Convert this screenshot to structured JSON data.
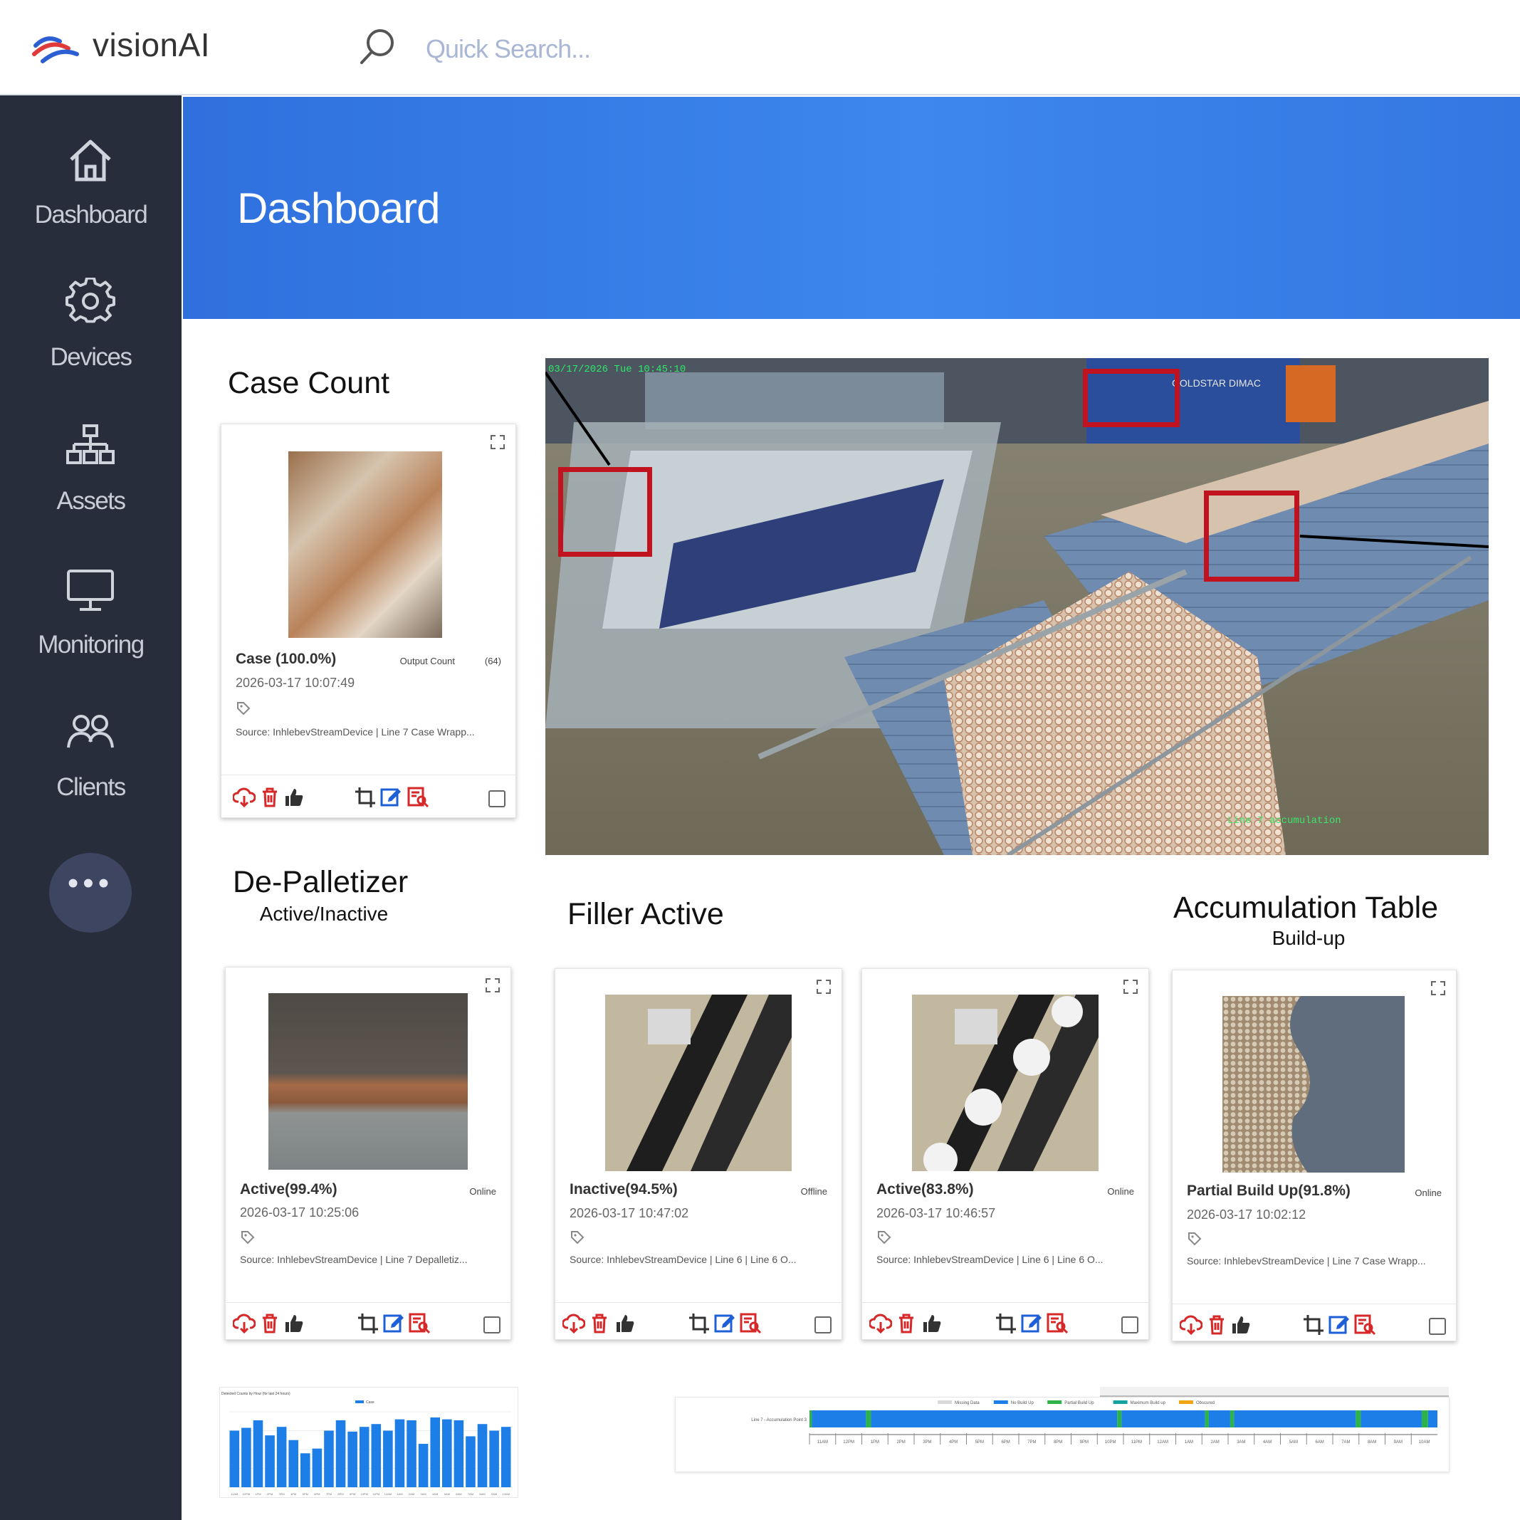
{
  "app": {
    "name": "visionAI"
  },
  "search": {
    "placeholder": "Quick Search..."
  },
  "sidebar": {
    "items": [
      {
        "label": "Dashboard",
        "icon": "home-icon"
      },
      {
        "label": "Devices",
        "icon": "gear-icon"
      },
      {
        "label": "Assets",
        "icon": "hierarchy-icon"
      },
      {
        "label": "Monitoring",
        "icon": "monitor-icon"
      },
      {
        "label": "Clients",
        "icon": "users-icon"
      }
    ],
    "more_label": "•••"
  },
  "page": {
    "title": "Dashboard"
  },
  "sections": {
    "case_count": {
      "title": "Case Count"
    },
    "depalletizer": {
      "title": "De-Palletizer",
      "subtitle": "Active/Inactive"
    },
    "filler": {
      "title": "Filler Active"
    },
    "accumulation": {
      "title": "Accumulation Table",
      "subtitle": "Build-up"
    }
  },
  "cards": {
    "case": {
      "status": "Case (100.0%)",
      "state": "Output Count",
      "count": "(64)",
      "time": "2026-03-17 10:07:49",
      "source": "Source: InhlebevStreamDevice | Line 7 Case Wrapp..."
    },
    "depal": {
      "status": "Active(99.4%)",
      "state": "Online",
      "time": "2026-03-17 10:25:06",
      "source": "Source: InhlebevStreamDevice | Line 7 Depalletiz..."
    },
    "filler1": {
      "status": "Inactive(94.5%)",
      "state": "Offline",
      "time": "2026-03-17 10:47:02",
      "source": "Source: InhlebevStreamDevice | Line 6 | Line 6 O..."
    },
    "filler2": {
      "status": "Active(83.8%)",
      "state": "Online",
      "time": "2026-03-17 10:46:57",
      "source": "Source: InhlebevStreamDevice | Line 6 | Line 6 O..."
    },
    "accum": {
      "status": "Partial Build Up(91.8%)",
      "state": "Online",
      "time": "2026-03-17 10:02:12",
      "source": "Source: InhlebevStreamDevice | Line 7 Case Wrapp..."
    }
  },
  "camera": {
    "timestamp": "03/17/2026 Tue 10:45:10",
    "caption": "Line 7 accumulation",
    "brand": "GOLDSTAR DIMAC"
  },
  "colors": {
    "accent": "#3478e6",
    "sidebar": "#272d3a",
    "action_red": "#d62828",
    "bar_blue": "#1c7ee6",
    "status_green": "#2db34a",
    "status_teal": "#14a3a0",
    "status_orange": "#f0a515",
    "status_gray": "#d9d9d9"
  },
  "chart_data": [
    {
      "type": "bar",
      "title": "Detected Counts by Hour (for last 24 hours)",
      "legend": [
        "Case"
      ],
      "legend_position": "top-center",
      "categories": [
        "11AM",
        "12PM",
        "1PM",
        "2PM",
        "3PM",
        "4PM",
        "5PM",
        "6PM",
        "7PM",
        "8PM",
        "9PM",
        "10PM",
        "11PM",
        "12AM",
        "1AM",
        "2AM",
        "3AM",
        "4AM",
        "5AM",
        "6AM",
        "7AM",
        "8AM",
        "9AM",
        "10AM"
      ],
      "values": [
        60,
        63,
        71,
        55,
        64,
        50,
        36,
        41,
        60,
        71,
        59,
        64,
        67,
        60,
        72,
        71,
        46,
        74,
        72,
        71,
        54,
        67,
        60,
        64
      ],
      "ylim": [
        0,
        80
      ],
      "grid": true
    },
    {
      "type": "table",
      "title": "",
      "row_label": "Line 7 - Accumulation Point 3",
      "legend": [
        "Missing Data",
        "No Build Up",
        "Partial Build Up",
        "Maximum Build up",
        "Obscured"
      ],
      "legend_position": "top-center",
      "x_ticks": [
        "11AM",
        "12PM",
        "1PM",
        "2PM",
        "3PM",
        "4PM",
        "5PM",
        "6PM",
        "7PM",
        "8PM",
        "9PM",
        "10PM",
        "11PM",
        "12AM",
        "1AM",
        "2AM",
        "3AM",
        "4AM",
        "5AM",
        "6AM",
        "7AM",
        "8AM",
        "9AM",
        "10AM"
      ],
      "segments": [
        {
          "state": "Partial Build Up",
          "start": 0.0,
          "end": 0.004
        },
        {
          "state": "No Build Up",
          "start": 0.004,
          "end": 0.09
        },
        {
          "state": "Partial Build Up",
          "start": 0.09,
          "end": 0.098
        },
        {
          "state": "No Build Up",
          "start": 0.098,
          "end": 0.49
        },
        {
          "state": "Partial Build Up",
          "start": 0.49,
          "end": 0.497
        },
        {
          "state": "No Build Up",
          "start": 0.497,
          "end": 0.63
        },
        {
          "state": "Partial Build Up",
          "start": 0.63,
          "end": 0.636
        },
        {
          "state": "No Build Up",
          "start": 0.636,
          "end": 0.67
        },
        {
          "state": "Partial Build Up",
          "start": 0.67,
          "end": 0.676
        },
        {
          "state": "No Build Up",
          "start": 0.676,
          "end": 0.87
        },
        {
          "state": "Partial Build Up",
          "start": 0.87,
          "end": 0.878
        },
        {
          "state": "No Build Up",
          "start": 0.878,
          "end": 0.975
        },
        {
          "state": "Partial Build Up",
          "start": 0.975,
          "end": 0.985
        },
        {
          "state": "No Build Up",
          "start": 0.985,
          "end": 1.0
        }
      ]
    }
  ]
}
